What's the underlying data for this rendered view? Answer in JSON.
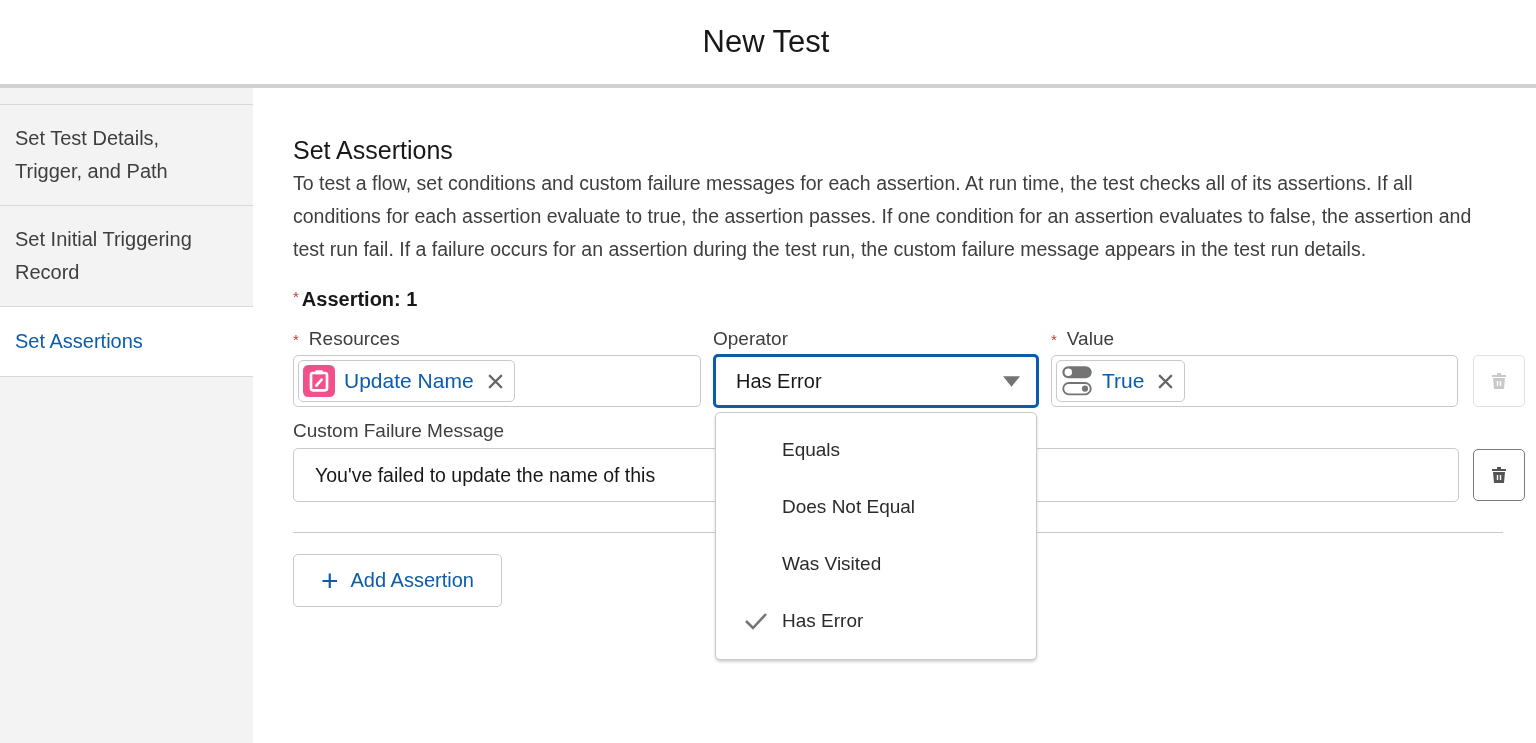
{
  "window": {
    "title": "New Test"
  },
  "sidebar": {
    "items": [
      {
        "label": "Set Test Details, Trigger, and Path",
        "selected": false
      },
      {
        "label": "Set Initial Triggering Record",
        "selected": false
      },
      {
        "label": "Set Assertions",
        "selected": true
      }
    ]
  },
  "section": {
    "title": "Set Assertions",
    "description": "To test a flow, set conditions and custom failure messages for each assertion. At run time, the test checks all of its assertions. If all conditions for each assertion evaluate to true, the assertion passes. If one condition for an assertion evaluates to false, the assertion and test run fail. If a failure occurs for an assertion during the test run, the custom failure message appears in the test run details."
  },
  "assertion": {
    "required_mark": "*",
    "title": "Assertion: 1",
    "resources": {
      "label": "Resources",
      "required": true,
      "pill": "Update Name"
    },
    "operator": {
      "label": "Operator",
      "required": false,
      "value": "Has Error",
      "expanded": true,
      "options": [
        {
          "label": "Equals",
          "selected": false
        },
        {
          "label": "Does Not Equal",
          "selected": false
        },
        {
          "label": "Was Visited",
          "selected": false
        },
        {
          "label": "Has Error",
          "selected": true
        }
      ]
    },
    "value": {
      "label": "Value",
      "required": true,
      "pill": "True"
    },
    "condition_delete": {
      "disabled": true
    },
    "failure_message": {
      "label": "Custom Failure Message",
      "value": "You've failed to update the name of this"
    },
    "message_delete": {
      "disabled": false
    }
  },
  "add_button": {
    "icon": "+",
    "label": "Add Assertion"
  }
}
